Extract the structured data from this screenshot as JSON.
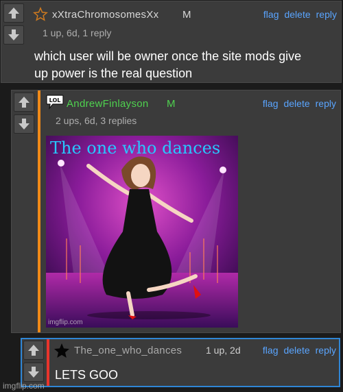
{
  "comments": [
    {
      "username": "xXtraChromosomesXx",
      "mod": "M",
      "badge": "star-outline-icon",
      "meta": "1 up, 6d, 1 reply",
      "text_lines": [
        "which user will be owner once the site mods give",
        "up power is the real question"
      ],
      "actions": {
        "flag": "flag",
        "delete": "delete",
        "reply": "reply"
      }
    },
    {
      "username": "AndrewFinlayson",
      "mod": "M",
      "badge": "lol-icon",
      "badge_text": "LOL",
      "meta": "2 ups, 6d, 3 replies",
      "image_title": "The one who dances",
      "image_watermark": "imgflip.com",
      "actions": {
        "flag": "flag",
        "delete": "delete",
        "reply": "reply"
      }
    },
    {
      "username": "The_one_who_dances",
      "badge": "star-filled-icon",
      "meta": "1 up, 2d",
      "text": "LETS GOO",
      "actions": {
        "flag": "flag",
        "delete": "delete",
        "reply": "reply"
      }
    }
  ],
  "watermark": "imgflip.com",
  "colors": {
    "link": "#5aa5ff",
    "username_default": "#d8d8d8",
    "username_green": "#4fd24f",
    "accent_orange": "#f08a18",
    "accent_red": "#e8342c",
    "accent_blue_border": "#2f86d6",
    "mod_default": "#d8d8d8",
    "mod_green": "#4fd24f"
  }
}
